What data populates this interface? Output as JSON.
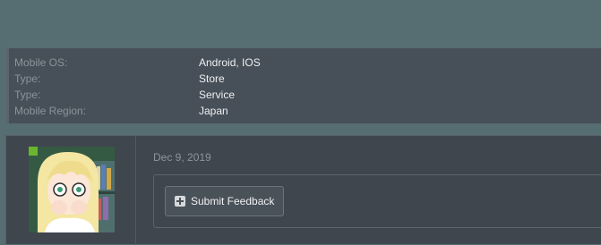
{
  "details": [
    {
      "label": "Mobile OS:",
      "value": "Android, IOS"
    },
    {
      "label": "Type:",
      "value": "Store"
    },
    {
      "label": "Type:",
      "value": "Service"
    },
    {
      "label": "Mobile Region:",
      "value": "Japan"
    }
  ],
  "post": {
    "date": "Dec 9, 2019",
    "feedback_button_label": "Submit Feedback",
    "feedback_icon": "plus-square-icon"
  },
  "colors": {
    "page_background": "#566d72",
    "panel_background": "#474f58",
    "post_background": "#3f464e",
    "text_primary": "#eef0f2",
    "text_muted": "#8b939a"
  }
}
